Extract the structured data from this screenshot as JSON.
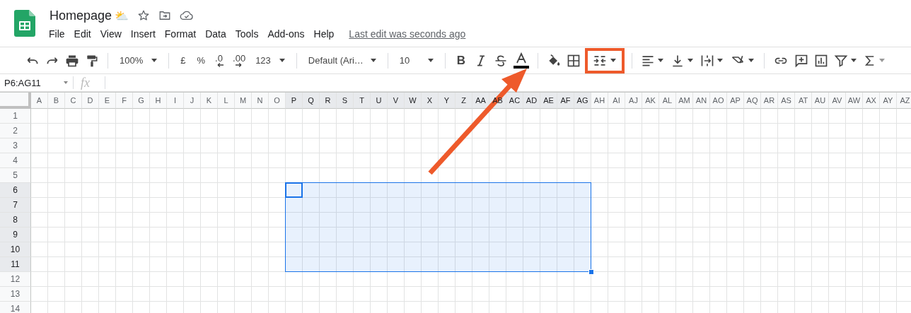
{
  "document": {
    "title": "Homepage",
    "title_emoji": "⛅"
  },
  "menu": [
    "File",
    "Edit",
    "View",
    "Insert",
    "Format",
    "Data",
    "Tools",
    "Add-ons",
    "Help"
  ],
  "last_edit": "Last edit was seconds ago",
  "toolbar": {
    "zoom": "100%",
    "currency": "£",
    "percent": "%",
    "decrease_decimal": ".0",
    "increase_decimal": ".00",
    "number_format": "123",
    "font": "Default (Ari…",
    "font_size": "10",
    "bold": "B",
    "merge_highlighted": true
  },
  "name_box": "P6:AG11",
  "formula_icon": "fx",
  "sheet": {
    "columns": [
      {
        "label": "A",
        "selected": false
      },
      {
        "label": "B",
        "selected": false
      },
      {
        "label": "C",
        "selected": false
      },
      {
        "label": "D",
        "selected": false
      },
      {
        "label": "E",
        "selected": false
      },
      {
        "label": "F",
        "selected": false
      },
      {
        "label": "G",
        "selected": false
      },
      {
        "label": "H",
        "selected": false
      },
      {
        "label": "I",
        "selected": false
      },
      {
        "label": "J",
        "selected": false
      },
      {
        "label": "K",
        "selected": false
      },
      {
        "label": "L",
        "selected": false
      },
      {
        "label": "M",
        "selected": false
      },
      {
        "label": "N",
        "selected": false
      },
      {
        "label": "O",
        "selected": false
      },
      {
        "label": "P",
        "selected": true
      },
      {
        "label": "Q",
        "selected": true
      },
      {
        "label": "R",
        "selected": true
      },
      {
        "label": "S",
        "selected": true
      },
      {
        "label": "T",
        "selected": true
      },
      {
        "label": "U",
        "selected": true
      },
      {
        "label": "V",
        "selected": true
      },
      {
        "label": "W",
        "selected": true
      },
      {
        "label": "X",
        "selected": true
      },
      {
        "label": "Y",
        "selected": true
      },
      {
        "label": "Z",
        "selected": true
      },
      {
        "label": "AA",
        "selected": true
      },
      {
        "label": "AB",
        "selected": true
      },
      {
        "label": "AC",
        "selected": true
      },
      {
        "label": "AD",
        "selected": true
      },
      {
        "label": "AE",
        "selected": true
      },
      {
        "label": "AF",
        "selected": true
      },
      {
        "label": "AG",
        "selected": true
      },
      {
        "label": "AH",
        "selected": false
      },
      {
        "label": "AI",
        "selected": false
      },
      {
        "label": "AJ",
        "selected": false
      },
      {
        "label": "AK",
        "selected": false
      },
      {
        "label": "AL",
        "selected": false
      },
      {
        "label": "AM",
        "selected": false
      },
      {
        "label": "AN",
        "selected": false
      },
      {
        "label": "AO",
        "selected": false
      },
      {
        "label": "AP",
        "selected": false
      },
      {
        "label": "AQ",
        "selected": false
      },
      {
        "label": "AR",
        "selected": false
      },
      {
        "label": "AS",
        "selected": false
      },
      {
        "label": "AT",
        "selected": false
      },
      {
        "label": "AU",
        "selected": false
      },
      {
        "label": "AV",
        "selected": false
      },
      {
        "label": "AW",
        "selected": false
      },
      {
        "label": "AX",
        "selected": false
      },
      {
        "label": "AY",
        "selected": false
      },
      {
        "label": "AZ",
        "selected": false
      }
    ],
    "rows": [
      {
        "label": "1",
        "selected": false
      },
      {
        "label": "2",
        "selected": false
      },
      {
        "label": "3",
        "selected": false
      },
      {
        "label": "4",
        "selected": false
      },
      {
        "label": "5",
        "selected": false
      },
      {
        "label": "6",
        "selected": true
      },
      {
        "label": "7",
        "selected": true
      },
      {
        "label": "8",
        "selected": true
      },
      {
        "label": "9",
        "selected": true
      },
      {
        "label": "10",
        "selected": true
      },
      {
        "label": "11",
        "selected": true
      },
      {
        "label": "12",
        "selected": false
      },
      {
        "label": "13",
        "selected": false
      },
      {
        "label": "14",
        "selected": false
      }
    ]
  }
}
